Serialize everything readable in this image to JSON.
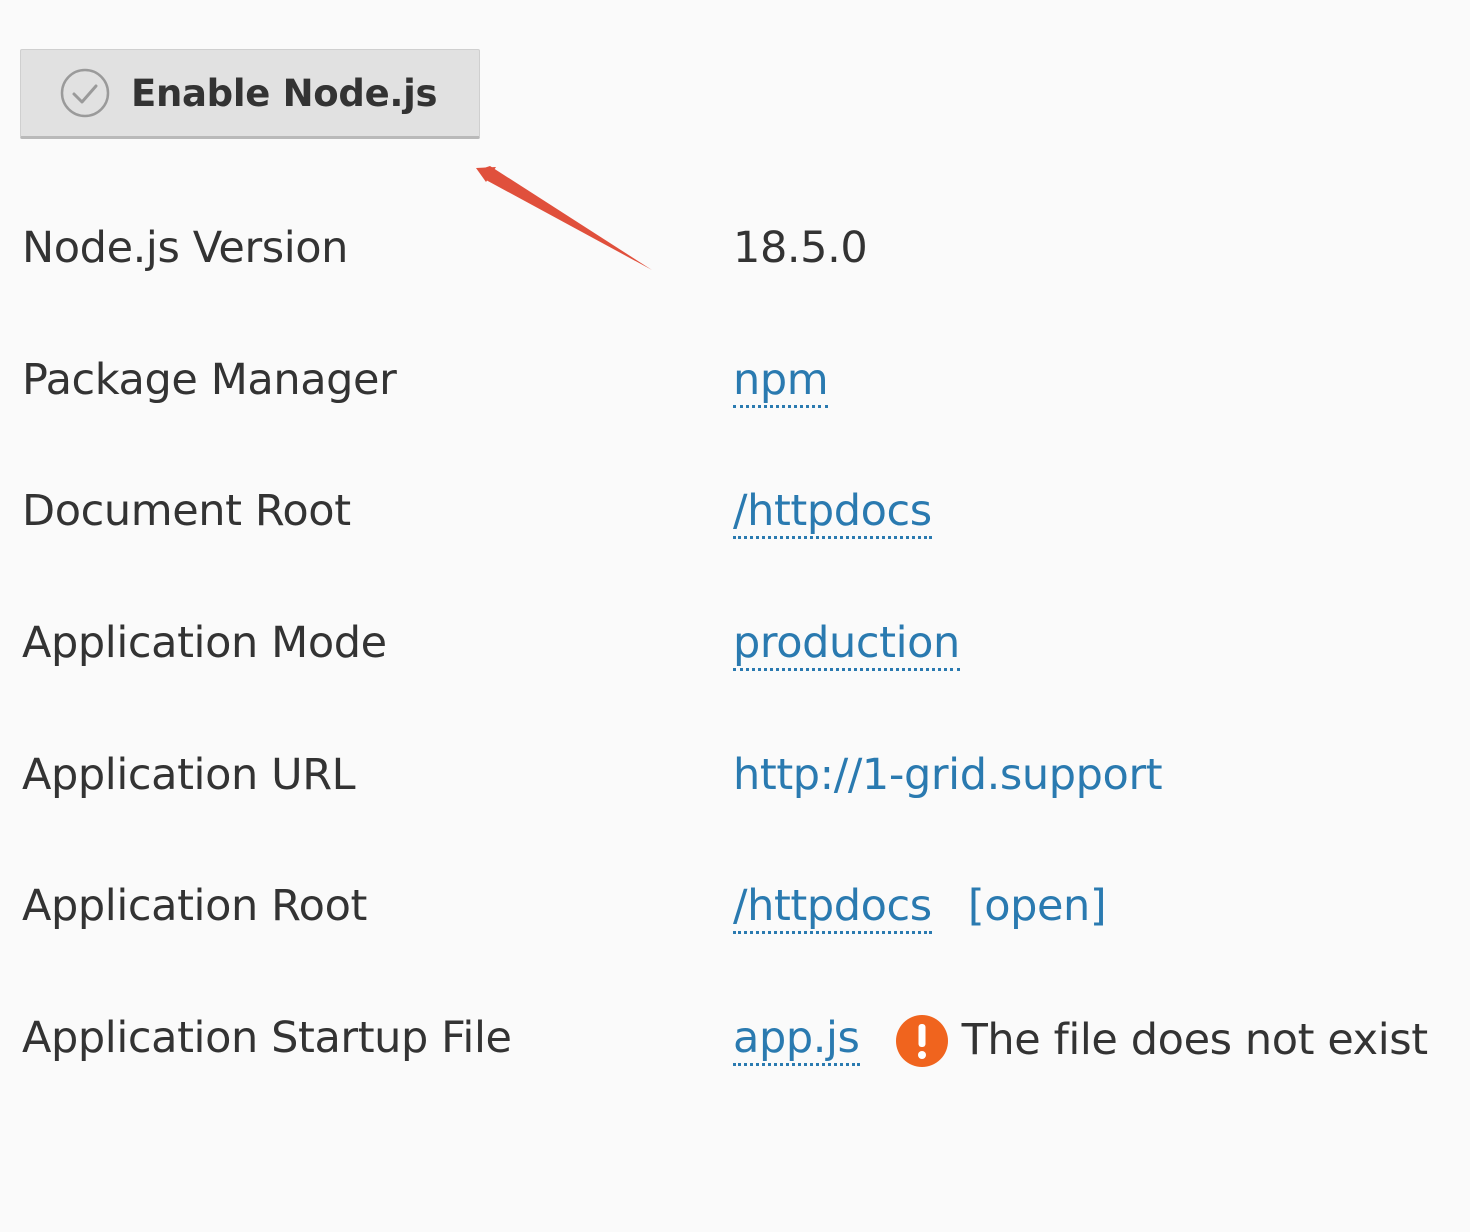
{
  "enable_button": {
    "label": "Enable Node.js",
    "icon": "check-circle-icon"
  },
  "settings": [
    {
      "label": "Node.js Version",
      "value": "18.5.0",
      "kind": "plain"
    },
    {
      "label": "Package Manager",
      "value": "npm",
      "kind": "dotted-link"
    },
    {
      "label": "Document Root",
      "value": "/httpdocs",
      "kind": "dotted-link"
    },
    {
      "label": "Application Mode",
      "value": "production",
      "kind": "dotted-link"
    },
    {
      "label": "Application URL",
      "value": "http://1-grid.support",
      "kind": "link"
    },
    {
      "label": "Application Root",
      "value": "/httpdocs",
      "kind": "dotted-link",
      "extra_link": "[open]"
    },
    {
      "label": "Application Startup File",
      "value": "app.js",
      "kind": "dotted-link",
      "warning": "The file does not exist",
      "warning_icon": "exclamation-circle-icon"
    }
  ],
  "colors": {
    "link": "#2a7ab0",
    "warning": "#f0641e",
    "annotation_arrow": "#e0503c",
    "button_bg": "#e1e1e1"
  }
}
